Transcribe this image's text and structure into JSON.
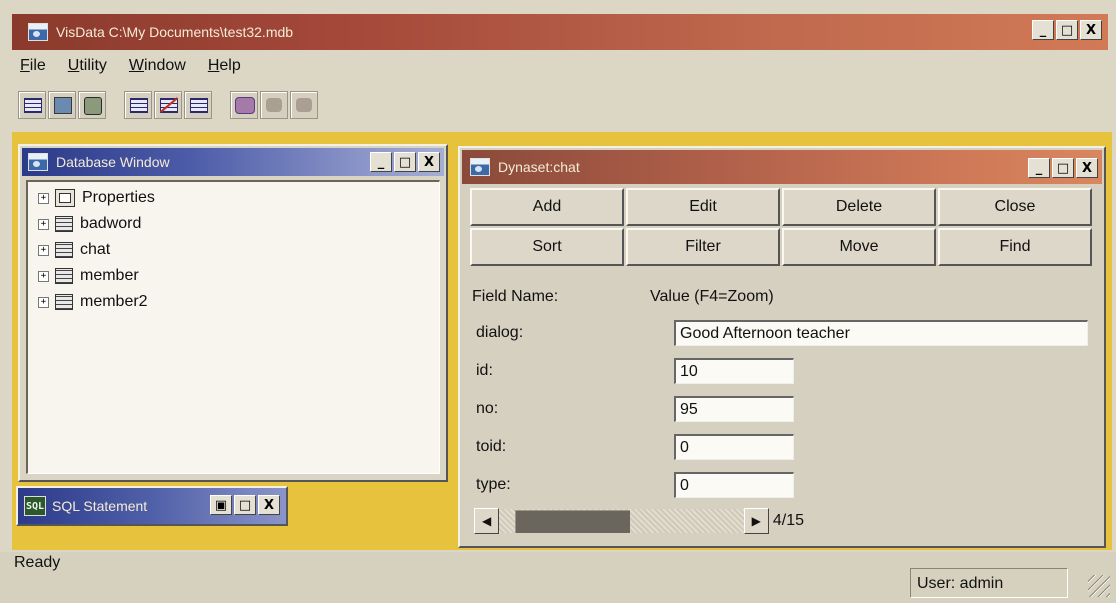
{
  "app": {
    "title": "VisData C:\\My Documents\\test32.mdb",
    "window_buttons": [
      "_",
      "□",
      "X"
    ]
  },
  "menu": [
    "File",
    "Utility",
    "Window",
    "Help"
  ],
  "toolbar": {
    "icons": [
      "table-type-icon",
      "dynaset-type-icon",
      "snapshot-type-icon",
      "data-control-icon",
      "no-data-control-icon",
      "dbgrid-control-icon",
      "begin-transaction-icon",
      "commit-icon",
      "rollback-icon"
    ]
  },
  "database_window": {
    "title": "Database Window",
    "items": [
      {
        "label": "Properties",
        "icon": "properties-icon"
      },
      {
        "label": "badword",
        "icon": "table-icon"
      },
      {
        "label": "chat",
        "icon": "table-icon"
      },
      {
        "label": "member",
        "icon": "table-icon"
      },
      {
        "label": "member2",
        "icon": "table-icon"
      }
    ]
  },
  "sql_window": {
    "title": "SQL Statement",
    "icon_text": "SQL"
  },
  "dynaset": {
    "title": "Dynaset:chat",
    "buttons": [
      "Add",
      "Edit",
      "Delete",
      "Close",
      "Sort",
      "Filter",
      "Move",
      "Find"
    ],
    "header_field": "Field Name:",
    "header_value": "Value (F4=Zoom)",
    "fields": [
      {
        "name": "dialog:",
        "value": "Good Afternoon teacher"
      },
      {
        "name": "id:",
        "value": "10"
      },
      {
        "name": "no:",
        "value": "95"
      },
      {
        "name": "toid:",
        "value": "0"
      },
      {
        "name": "type:",
        "value": "0"
      }
    ],
    "record_position": "4/15"
  },
  "status": {
    "text": "Ready",
    "user": "User: admin"
  }
}
